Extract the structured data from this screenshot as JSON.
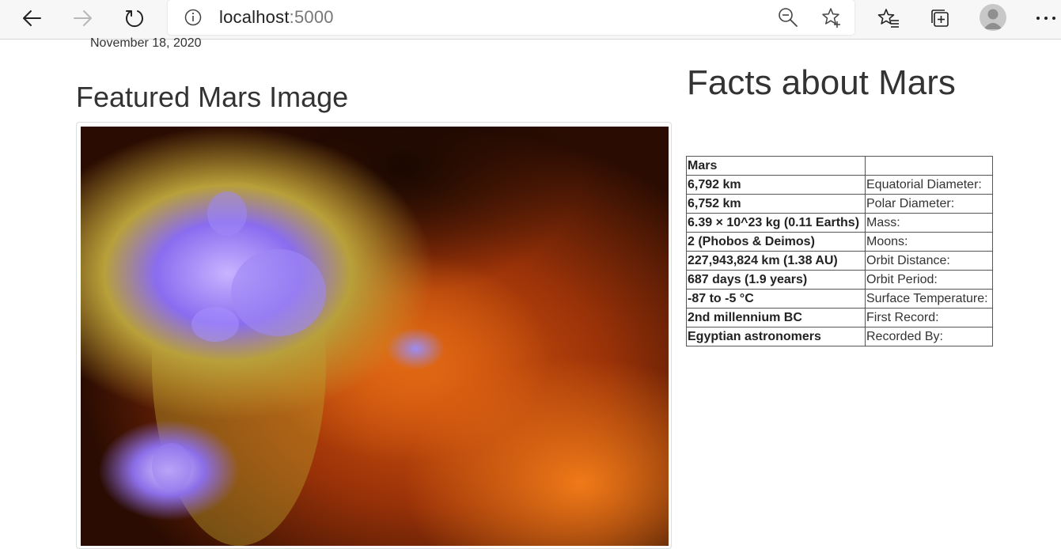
{
  "browser": {
    "url_host": "localhost",
    "url_port": ":5000",
    "icons": [
      "back-arrow-icon",
      "forward-arrow-icon",
      "refresh-icon",
      "info-icon",
      "zoom-out-icon",
      "add-favorite-icon",
      "favorites-icon",
      "collections-icon",
      "profile-icon",
      "more-icon"
    ]
  },
  "page": {
    "date": "November 18, 2020",
    "featured_title": "Featured Mars Image",
    "facts_title": "Facts about Mars"
  },
  "facts_table": {
    "header": [
      "Mars",
      ""
    ],
    "rows": [
      [
        "6,792 km",
        "Equatorial Diameter:"
      ],
      [
        "6,752 km",
        "Polar Diameter:"
      ],
      [
        "6.39 × 10^23 kg (0.11 Earths)",
        "Mass:"
      ],
      [
        "2 (Phobos & Deimos)",
        "Moons:"
      ],
      [
        "227,943,824 km (1.38 AU)",
        "Orbit Distance:"
      ],
      [
        "687 days (1.9 years)",
        "Orbit Period:"
      ],
      [
        "-87 to -5 °C",
        "Surface Temperature:"
      ],
      [
        "2nd millennium BC",
        "First Record:"
      ],
      [
        "Egyptian astronomers",
        "Recorded By:"
      ]
    ]
  },
  "colors": {
    "toolbar_bg": "#f7f7f7",
    "text": "#333333",
    "image_nebula_orange": "#d9580f",
    "image_nebula_violet": "#8a6cf0"
  }
}
